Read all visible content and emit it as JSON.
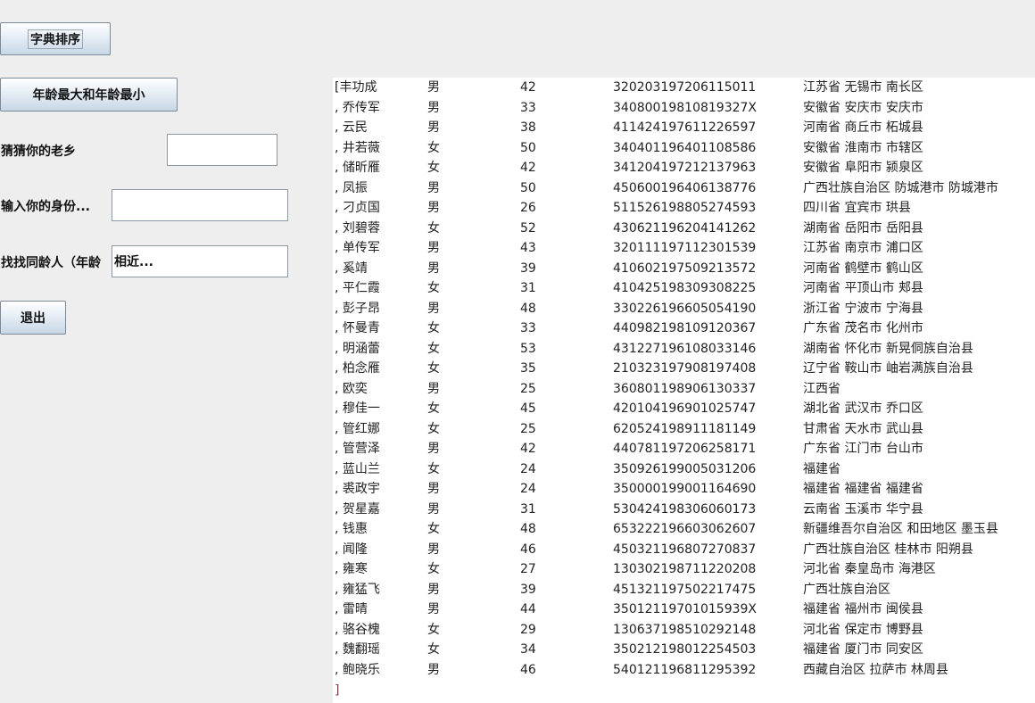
{
  "buttons": {
    "sort": "字典排序",
    "age_extremes": "年龄最大和年龄最小",
    "exit": "退出"
  },
  "fields": {
    "hometown": {
      "label": "猜猜你的老乡",
      "value": ""
    },
    "province": {
      "label": "输入你的身份...",
      "value": ""
    },
    "peers": {
      "label": "找找同龄人（年龄",
      "value": "相近..."
    }
  },
  "results": {
    "close_bracket": "]",
    "rows": [
      {
        "name": "[丰功成",
        "sex": "男",
        "age": "42",
        "id": "320203197206115011",
        "addr": "江苏省 无锡市 南长区"
      },
      {
        "name": ", 乔传军",
        "sex": "男",
        "age": "33",
        "id": "34080019810819327X",
        "addr": "安徽省 安庆市 安庆市"
      },
      {
        "name": ", 云民",
        "sex": "男",
        "age": "38",
        "id": "411424197611226597",
        "addr": "河南省 商丘市 柘城县"
      },
      {
        "name": ", 井若薇",
        "sex": "女",
        "age": "50",
        "id": "340401196401108586",
        "addr": "安徽省 淮南市 市辖区"
      },
      {
        "name": ", 储昕雁",
        "sex": "女",
        "age": "42",
        "id": "341204197212137963",
        "addr": "安徽省 阜阳市 颍泉区"
      },
      {
        "name": ", 凤振",
        "sex": "男",
        "age": "50",
        "id": "450600196406138776",
        "addr": "广西壮族自治区 防城港市 防城港市"
      },
      {
        "name": ", 刁贞国",
        "sex": "男",
        "age": "26",
        "id": "511526198805274593",
        "addr": "四川省 宜宾市 珙县"
      },
      {
        "name": ", 刘碧蓉",
        "sex": "女",
        "age": "52",
        "id": "430621196204141262",
        "addr": "湖南省 岳阳市 岳阳县"
      },
      {
        "name": ", 单传军",
        "sex": "男",
        "age": "43",
        "id": "320111197112301539",
        "addr": "江苏省 南京市 浦口区"
      },
      {
        "name": ", 奚靖",
        "sex": "男",
        "age": "39",
        "id": "410602197509213572",
        "addr": "河南省 鹤壁市 鹤山区"
      },
      {
        "name": ", 平仁霞",
        "sex": "女",
        "age": "31",
        "id": "410425198309308225",
        "addr": "河南省 平顶山市 郏县"
      },
      {
        "name": ", 彭子昂",
        "sex": "男",
        "age": "48",
        "id": "330226196605054190",
        "addr": "浙江省 宁波市 宁海县"
      },
      {
        "name": ", 怀曼青",
        "sex": "女",
        "age": "33",
        "id": "440982198109120367",
        "addr": "广东省 茂名市 化州市"
      },
      {
        "name": ", 明涵蕾",
        "sex": "女",
        "age": "53",
        "id": "431227196108033146",
        "addr": "湖南省 怀化市 新晃侗族自治县"
      },
      {
        "name": ", 柏念雁",
        "sex": "女",
        "age": "35",
        "id": "210323197908197408",
        "addr": "辽宁省 鞍山市 岫岩满族自治县"
      },
      {
        "name": ", 欧奕",
        "sex": "男",
        "age": "25",
        "id": "360801198906130337",
        "addr": "江西省"
      },
      {
        "name": ", 穆佳一",
        "sex": "女",
        "age": "45",
        "id": "420104196901025747",
        "addr": "湖北省 武汉市 乔口区"
      },
      {
        "name": ", 管红娜",
        "sex": "女",
        "age": "25",
        "id": "620524198911181149",
        "addr": "甘肃省 天水市 武山县"
      },
      {
        "name": ", 管营泽",
        "sex": "男",
        "age": "42",
        "id": "440781197206258171",
        "addr": "广东省 江门市 台山市"
      },
      {
        "name": ", 蓝山兰",
        "sex": "女",
        "age": "24",
        "id": "350926199005031206",
        "addr": "福建省"
      },
      {
        "name": ", 裘政宇",
        "sex": "男",
        "age": "24",
        "id": "350000199001164690",
        "addr": "福建省 福建省 福建省"
      },
      {
        "name": ", 贺星嘉",
        "sex": "男",
        "age": "31",
        "id": "530424198306060173",
        "addr": "云南省 玉溪市 华宁县"
      },
      {
        "name": ", 钱惠",
        "sex": "女",
        "age": "48",
        "id": "653222196603062607",
        "addr": "新疆维吾尔自治区 和田地区 墨玉县"
      },
      {
        "name": ", 闻隆",
        "sex": "男",
        "age": "46",
        "id": "450321196807270837",
        "addr": "广西壮族自治区 桂林市 阳朔县"
      },
      {
        "name": ", 雍寒",
        "sex": "女",
        "age": "27",
        "id": "130302198711220208",
        "addr": "河北省 秦皇岛市 海港区"
      },
      {
        "name": ", 雍猛飞",
        "sex": "男",
        "age": "39",
        "id": "451321197502217475",
        "addr": "广西壮族自治区"
      },
      {
        "name": ", 雷晴",
        "sex": "男",
        "age": "44",
        "id": "35012119701015939X",
        "addr": "福建省 福州市 闽侯县"
      },
      {
        "name": ", 骆谷槐",
        "sex": "女",
        "age": "29",
        "id": "130637198510292148",
        "addr": "河北省 保定市 博野县"
      },
      {
        "name": ", 魏翻瑶",
        "sex": "女",
        "age": "34",
        "id": "350212198012254503",
        "addr": "福建省 厦门市 同安区"
      },
      {
        "name": ", 鲍晓乐",
        "sex": "男",
        "age": "46",
        "id": "540121196811295392",
        "addr": "西藏自治区 拉萨市 林周县"
      }
    ]
  }
}
